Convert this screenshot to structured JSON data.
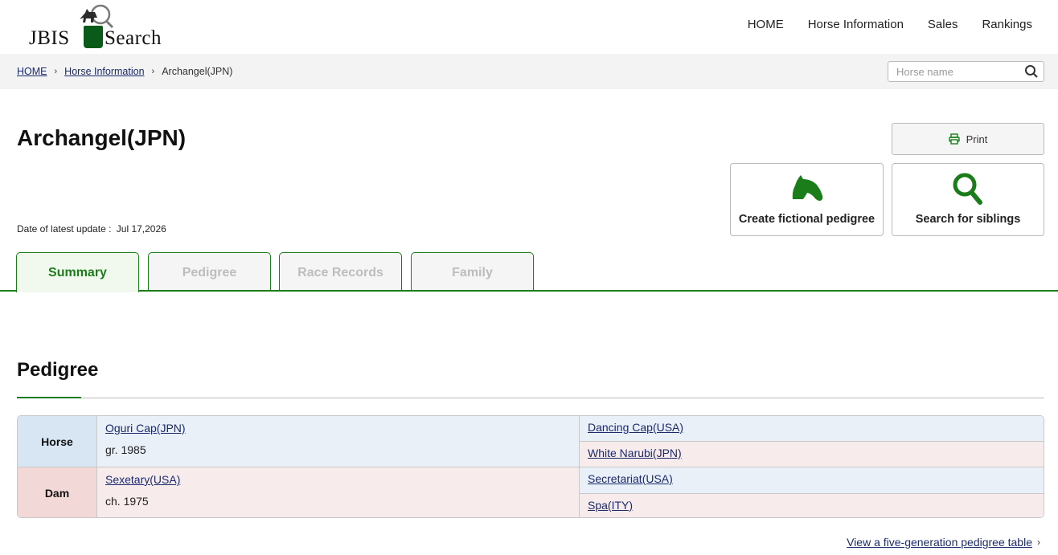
{
  "logo": {
    "left_text": "JBIS",
    "right_text": "Search"
  },
  "nav": {
    "items": [
      "HOME",
      "Horse Information",
      "Sales",
      "Rankings"
    ]
  },
  "breadcrumb": {
    "home": "HOME",
    "section": "Horse Information",
    "current": "Archangel(JPN)",
    "separator": "›"
  },
  "search": {
    "placeholder": "Horse name"
  },
  "horse": {
    "name": "Archangel(JPN)"
  },
  "update": {
    "label": "Date of latest update :",
    "date": "Jul 17,2026"
  },
  "buttons": {
    "print": "Print",
    "fictional_pedigree": "Create fictional pedigree",
    "siblings": "Search for siblings"
  },
  "tabs": [
    {
      "label": "Summary",
      "active": true
    },
    {
      "label": "Pedigree",
      "active": false
    },
    {
      "label": "Race Records",
      "active": false
    },
    {
      "label": "Family",
      "active": false
    }
  ],
  "pedigree_section": {
    "title": "Pedigree",
    "rows": [
      {
        "header": "Horse",
        "name": "Oguri Cap(JPN)",
        "detail": "gr. 1985",
        "sire": "Dancing Cap(USA)",
        "dam": "White Narubi(JPN)"
      },
      {
        "header": "Dam",
        "name": "Sexetary(USA)",
        "detail": "ch. 1975",
        "sire": "Secretariat(USA)",
        "dam": "Spa(ITY)"
      }
    ],
    "more_link": "View a five-generation pedigree table"
  },
  "colors": {
    "accent": "#1a7d1a",
    "link": "#1a2a6b",
    "male_bg": "#eaf0f7",
    "female_bg": "#f8ebeb"
  }
}
